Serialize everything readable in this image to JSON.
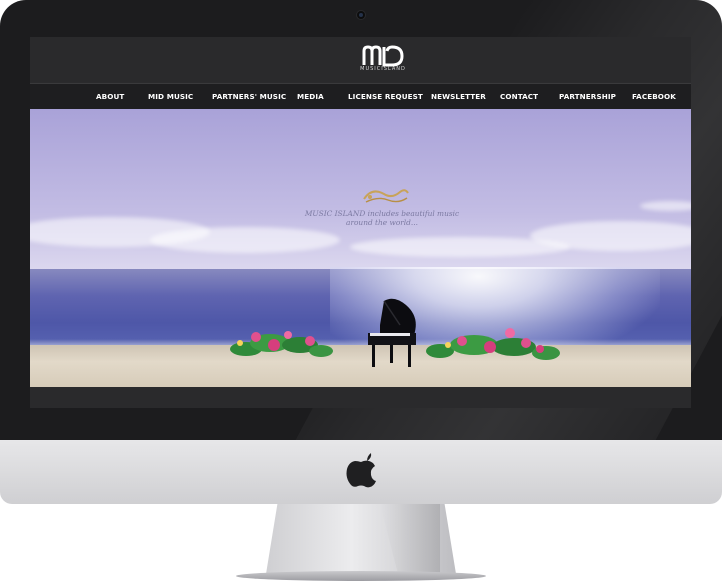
{
  "site": {
    "logo_text": "MUSICISLAND",
    "nav": [
      "ABOUT",
      "MID MUSIC",
      "PARTNERS' MUSIC",
      "MEDIA",
      "LICENSE REQUEST",
      "NEWSLETTER",
      "CONTACT",
      "PARTNERSHIP",
      "FACEBOOK"
    ],
    "hero": {
      "tagline_line1": "MUSIC ISLAND includes beautiful music",
      "tagline_line2": "around the world..."
    }
  },
  "icons": {
    "logo": "mid-logo",
    "ornament": "swirl-ornament-icon",
    "device_logo": "apple-icon",
    "camera": "camera-icon"
  },
  "colors": {
    "bezel": "#1c1c1e",
    "nav_bg": "#1e1e20",
    "nav_text": "#ffffff",
    "sky": "#b7b0df",
    "sea": "#4e57a8",
    "tagline": "#7c7aa2",
    "ornament": "#c8a35a"
  }
}
